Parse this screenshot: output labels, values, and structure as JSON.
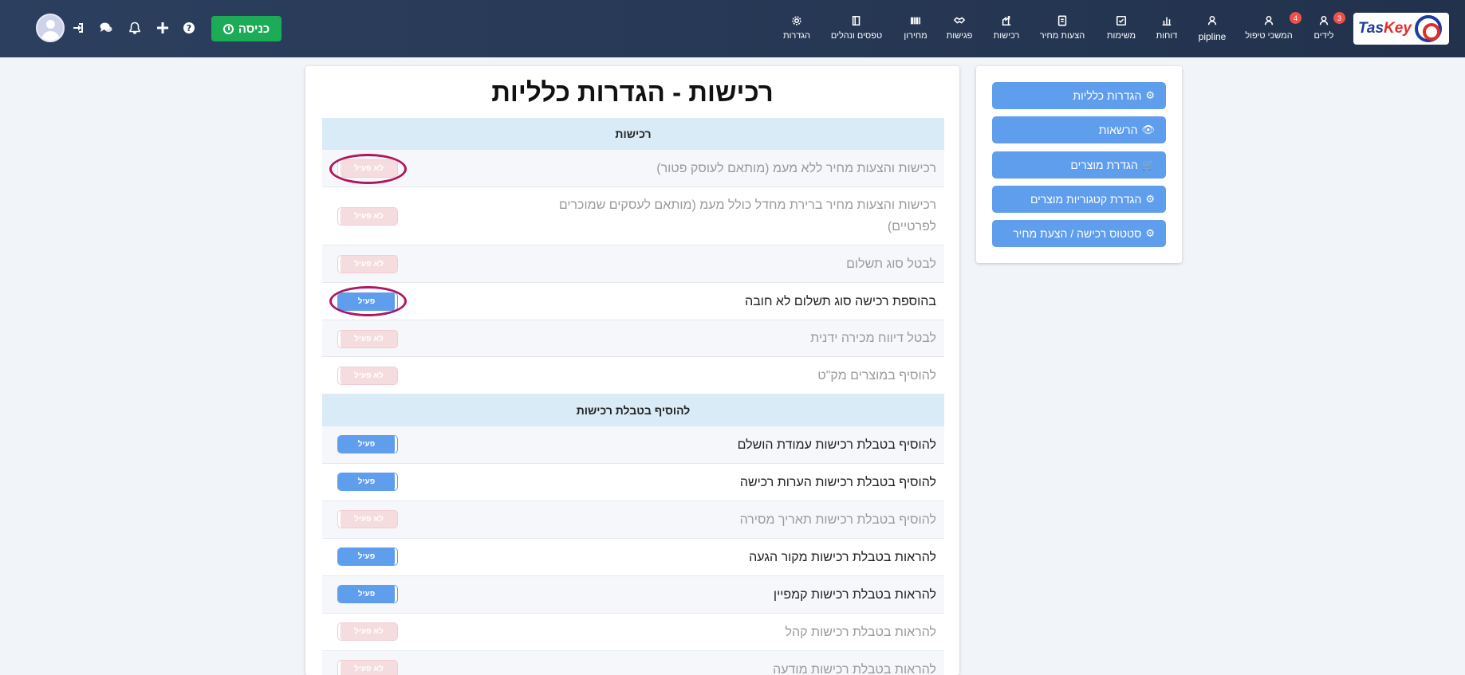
{
  "colors": {
    "accent": "#5f9ded",
    "enter": "#1cab56",
    "header": "#2c3f5e",
    "badge": "#f0504a",
    "highlight": "#b0165f"
  },
  "header": {
    "logo": {
      "word_main": "Tas",
      "word_accent": "Key"
    },
    "enter_button": "כניסה",
    "nav": [
      {
        "label": "לידים",
        "icon": "user-icon",
        "badge": "3"
      },
      {
        "label": "המשכי טיפול",
        "icon": "user-icon",
        "badge": "4"
      },
      {
        "label": "pipline",
        "icon": "user-icon"
      },
      {
        "label": "דוחות",
        "icon": "chart-icon"
      },
      {
        "label": "משימות",
        "icon": "checkbox-icon"
      },
      {
        "label": "הצעות מחיר",
        "icon": "document-icon"
      },
      {
        "label": "רכישות",
        "icon": "purchase-icon"
      },
      {
        "label": "פגישות",
        "icon": "handshake-icon"
      },
      {
        "label": "מחירון",
        "icon": "barcode-icon"
      },
      {
        "label": "טפסים ונהלים",
        "icon": "book-icon"
      },
      {
        "label": "הגדרות",
        "icon": "gear-icon"
      }
    ],
    "left_icons": [
      "login-icon",
      "chat-icon",
      "bell-icon",
      "plus-icon",
      "help-icon"
    ]
  },
  "side_menu": [
    {
      "label": "הגדרות כלליות",
      "icon": "gear-icon"
    },
    {
      "label": "הרשאות",
      "icon": "eye-slash-icon"
    },
    {
      "label": "הגדרת מוצרים",
      "icon": "cart-icon"
    },
    {
      "label": "הגדרת קטגוריות מוצרים",
      "icon": "gear-icon"
    },
    {
      "label": "סטטוס רכישה / הצעת מחיר",
      "icon": "gear-icon"
    }
  ],
  "main": {
    "title": "רכישות - הגדרות כלליות",
    "sections": [
      {
        "heading": "רכישות"
      },
      {
        "heading": "להוסיף בטבלת רכישות"
      }
    ],
    "toggle_on_label": "פעיל",
    "toggle_off_label": "לא פעיל",
    "rows": [
      {
        "label": "רכישות והצעות מחיר ללא מעמ (מותאם לעוסק פטור)",
        "state": "off"
      },
      {
        "label": "רכישות והצעות מחיר ברירת מחדל כולל מעמ (מותאם לעסקים שמוכרים לפרטיים)",
        "state": "off"
      },
      {
        "label": "לבטל סוג תשלום",
        "state": "off"
      },
      {
        "label": "בהוספת רכישה סוג תשלום לא חובה",
        "state": "on"
      },
      {
        "label": "לבטל דיווח מכירה ידנית",
        "state": "off"
      },
      {
        "label": "להוסיף במוצרים מק\"ט",
        "state": "off"
      },
      {
        "label": "להוסיף בטבלת רכישות עמודת הושלם",
        "state": "on"
      },
      {
        "label": "להוסיף בטבלת רכישות הערות רכישה",
        "state": "on"
      },
      {
        "label": "להוסיף בטבלת רכישות תאריך מסירה",
        "state": "off"
      },
      {
        "label": "להראות בטבלת רכישות מקור הגעה",
        "state": "on"
      },
      {
        "label": "להראות בטבלת רכישות קמפיין",
        "state": "on"
      },
      {
        "label": "להראות בטבלת רכישות קהל",
        "state": "off"
      },
      {
        "label": "להראות בטבלת רכישות מודעה",
        "state": "off"
      }
    ]
  }
}
